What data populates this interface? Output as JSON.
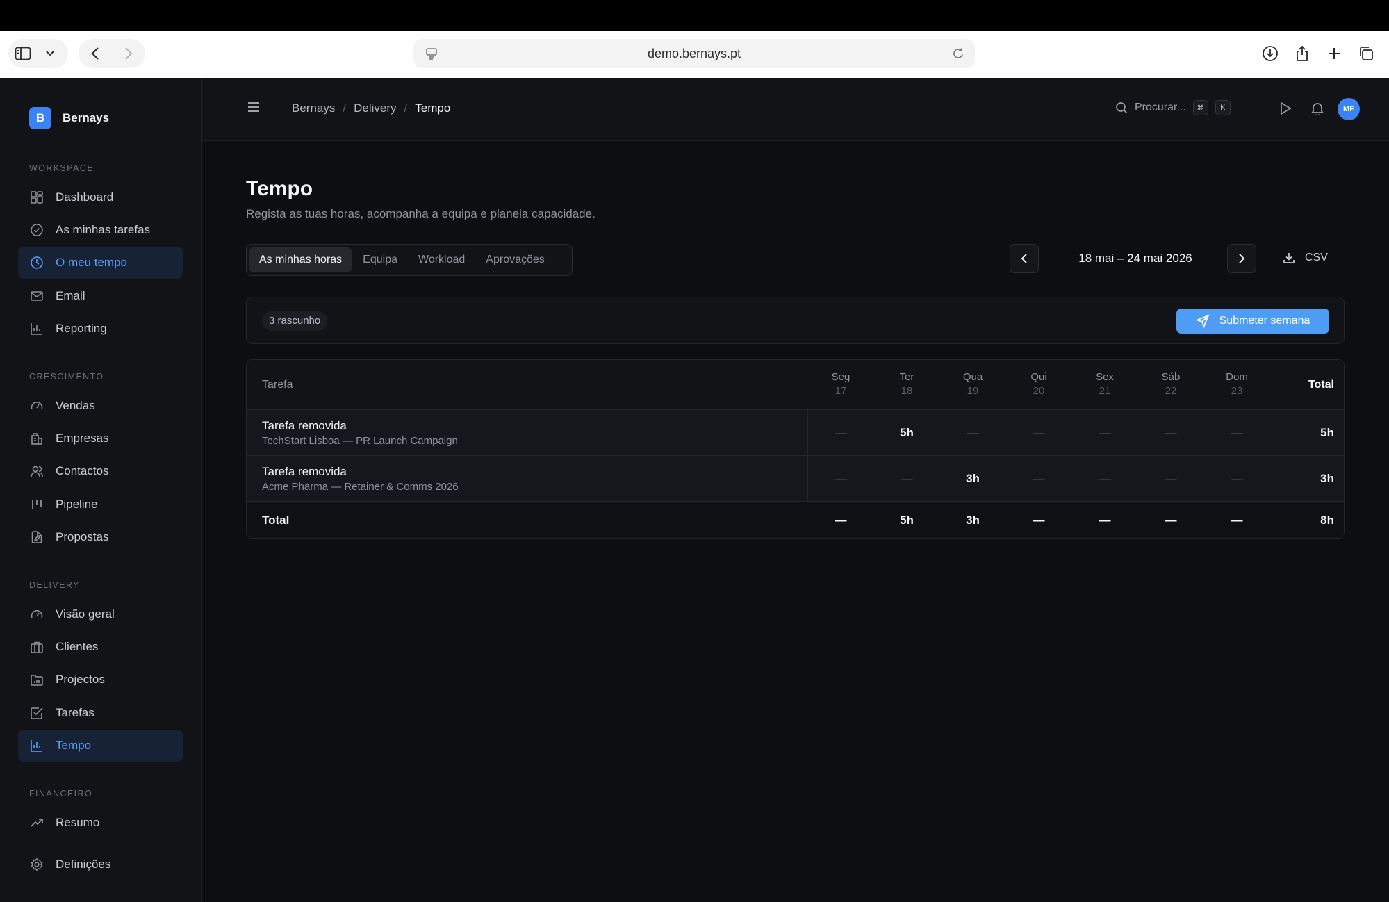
{
  "browser": {
    "url": "demo.bernays.pt"
  },
  "sidebar": {
    "brand_initial": "B",
    "brand_name": "Bernays",
    "sections": [
      {
        "title": "WORKSPACE",
        "items": [
          {
            "label": "Dashboard",
            "icon": "grid-icon"
          },
          {
            "label": "As minhas tarefas",
            "icon": "check-circle-icon"
          },
          {
            "label": "O meu tempo",
            "icon": "clock-icon",
            "active": true
          },
          {
            "label": "Email",
            "icon": "mail-icon"
          },
          {
            "label": "Reporting",
            "icon": "bar-chart-icon"
          }
        ]
      },
      {
        "title": "CRESCIMENTO",
        "items": [
          {
            "label": "Vendas",
            "icon": "gauge-icon"
          },
          {
            "label": "Empresas",
            "icon": "building-icon"
          },
          {
            "label": "Contactos",
            "icon": "users-icon"
          },
          {
            "label": "Pipeline",
            "icon": "kanban-icon"
          },
          {
            "label": "Propostas",
            "icon": "file-edit-icon"
          }
        ]
      },
      {
        "title": "DELIVERY",
        "items": [
          {
            "label": "Visão geral",
            "icon": "gauge-icon"
          },
          {
            "label": "Clientes",
            "icon": "briefcase-icon"
          },
          {
            "label": "Projectos",
            "icon": "folder-chart-icon"
          },
          {
            "label": "Tarefas",
            "icon": "check-square-icon"
          },
          {
            "label": "Tempo",
            "icon": "bar-chart-icon",
            "active": true
          }
        ]
      },
      {
        "title": "FINANCEIRO",
        "items": [
          {
            "label": "Resumo",
            "icon": "trending-up-icon"
          }
        ]
      }
    ],
    "settings_label": "Definições"
  },
  "header": {
    "breadcrumb": [
      "Bernays",
      "Delivery",
      "Tempo"
    ],
    "search_placeholder": "Procurar...",
    "shortcut_keys": [
      "⌘",
      "K"
    ],
    "avatar_initials": "MF"
  },
  "page": {
    "title": "Tempo",
    "subtitle": "Regista as tuas horas, acompanha a equipa e planeia capacidade.",
    "tabs": [
      "As minhas horas",
      "Equipa",
      "Workload",
      "Aprovações"
    ],
    "active_tab": 0,
    "week_label": "18 mai – 24 mai 2026",
    "export_label": "CSV"
  },
  "status": {
    "draft_label": "3 rascunho",
    "submit_label": "Submeter semana"
  },
  "timesheet": {
    "task_header": "Tarefa",
    "total_header": "Total",
    "days": [
      {
        "name": "Seg",
        "num": "17"
      },
      {
        "name": "Ter",
        "num": "18"
      },
      {
        "name": "Qua",
        "num": "19"
      },
      {
        "name": "Qui",
        "num": "20"
      },
      {
        "name": "Sex",
        "num": "21"
      },
      {
        "name": "Sáb",
        "num": "22"
      },
      {
        "name": "Dom",
        "num": "23"
      }
    ],
    "rows": [
      {
        "task": "Tarefa removida",
        "client": "TechStart Lisboa — PR Launch Campaign",
        "hours": [
          "—",
          "5h",
          "—",
          "—",
          "—",
          "—",
          "—"
        ],
        "total": "5h"
      },
      {
        "task": "Tarefa removida",
        "client": "Acme Pharma — Retainer & Comms 2026",
        "hours": [
          "—",
          "—",
          "3h",
          "—",
          "—",
          "—",
          "—"
        ],
        "total": "3h"
      }
    ],
    "footer": {
      "label": "Total",
      "hours": [
        "—",
        "5h",
        "3h",
        "—",
        "—",
        "—",
        "—"
      ],
      "total": "8h"
    }
  },
  "colors": {
    "accent": "#3b82f6",
    "active_nav_bg": "#172235",
    "active_nav_text": "#5da0ff",
    "submit_button": "#4f9cf5",
    "app_bg": "#0d0e12"
  }
}
